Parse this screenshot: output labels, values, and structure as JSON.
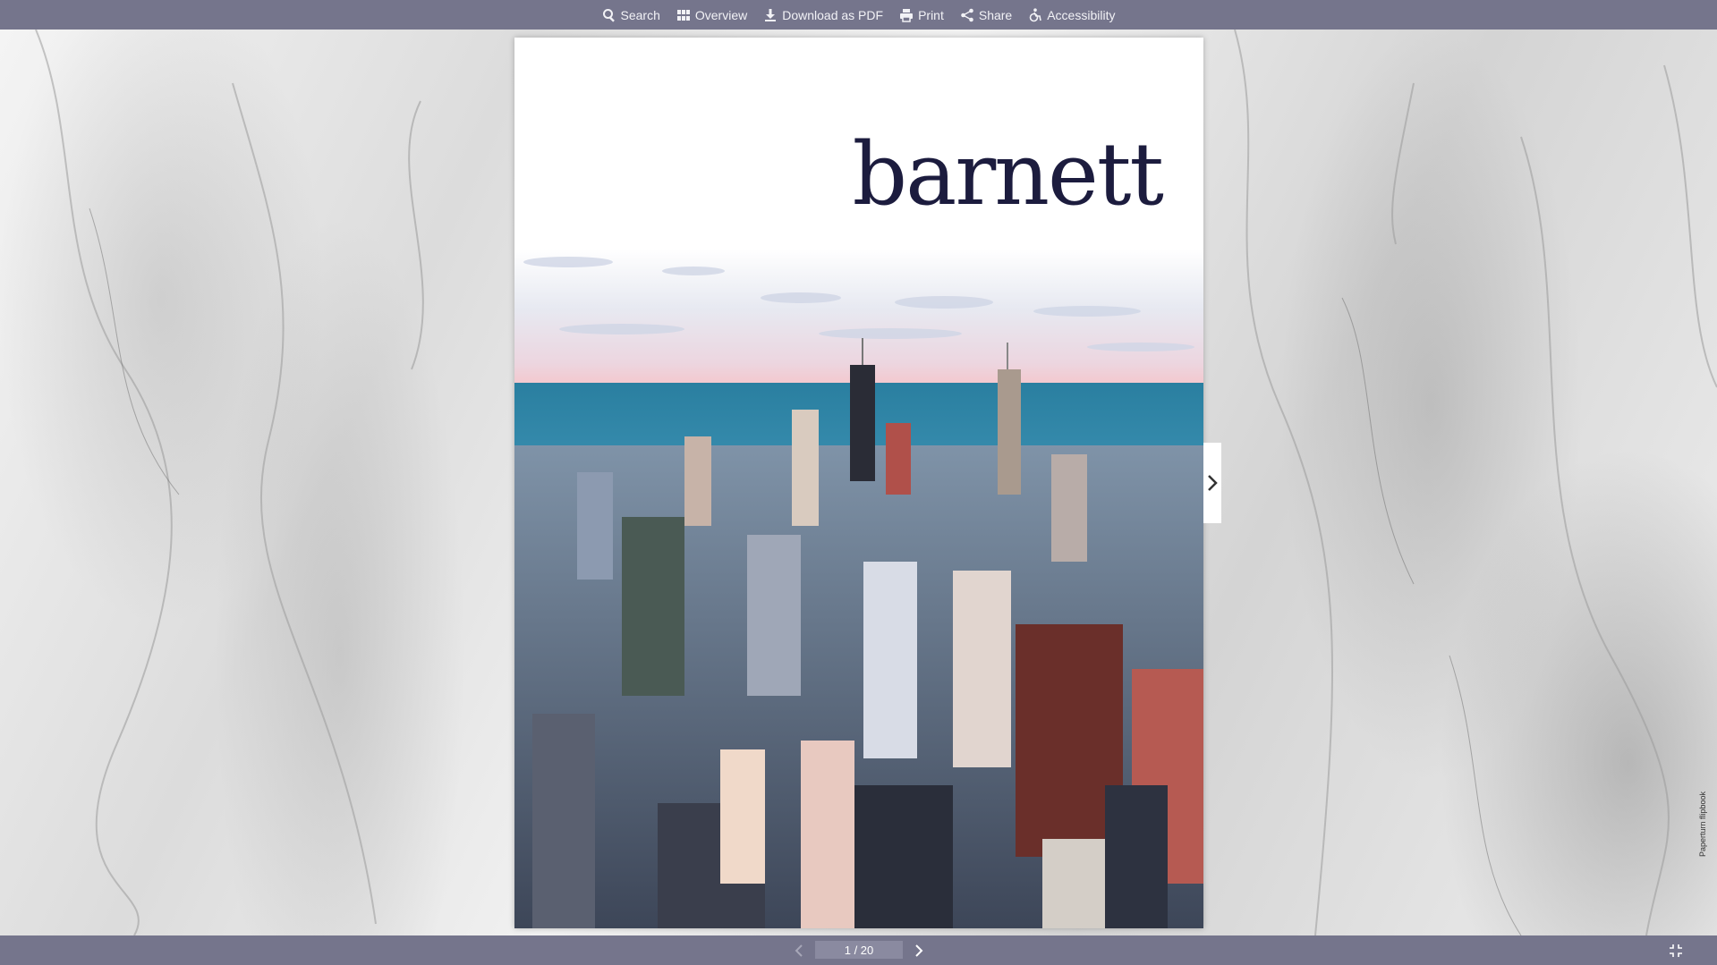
{
  "toolbar": {
    "search_label": "Search",
    "overview_label": "Overview",
    "download_label": "Download as PDF",
    "print_label": "Print",
    "share_label": "Share",
    "accessibility_label": "Accessibility"
  },
  "page": {
    "brand": "barnett",
    "photo_icon": "city-skyline-photo"
  },
  "navigation": {
    "page_indicator": "1 / 20",
    "credit": "Paperturn flipbook"
  },
  "colors": {
    "bar": "#75758c",
    "brand": "#1c1c3e"
  }
}
